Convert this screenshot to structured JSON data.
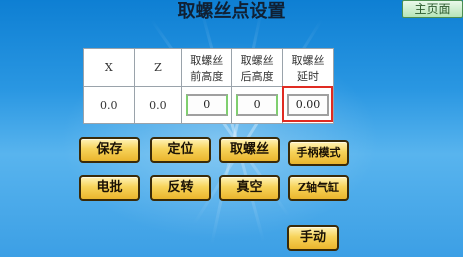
{
  "title": "取螺丝点设置",
  "home_button": "主页面",
  "table": {
    "headers": [
      "X",
      "Z",
      "取螺丝前高度",
      "取螺丝后高度",
      "取螺丝延时"
    ],
    "header_lines": [
      [
        "X"
      ],
      [
        "Z"
      ],
      [
        "取螺丝",
        "前高度"
      ],
      [
        "取螺丝",
        "后高度"
      ],
      [
        "取螺丝",
        "延时"
      ]
    ],
    "values": [
      "0.0",
      "0.0",
      "0",
      "0",
      "0.00"
    ]
  },
  "buttons": {
    "save": "保存",
    "position": "定位",
    "take_screw": "取螺丝",
    "handwheel_mode": "手柄模式",
    "electric_screwdriver": "电批",
    "reverse": "反转",
    "vacuum": "真空",
    "z_cylinder": "Z轴气缸",
    "manual": "手动"
  }
}
